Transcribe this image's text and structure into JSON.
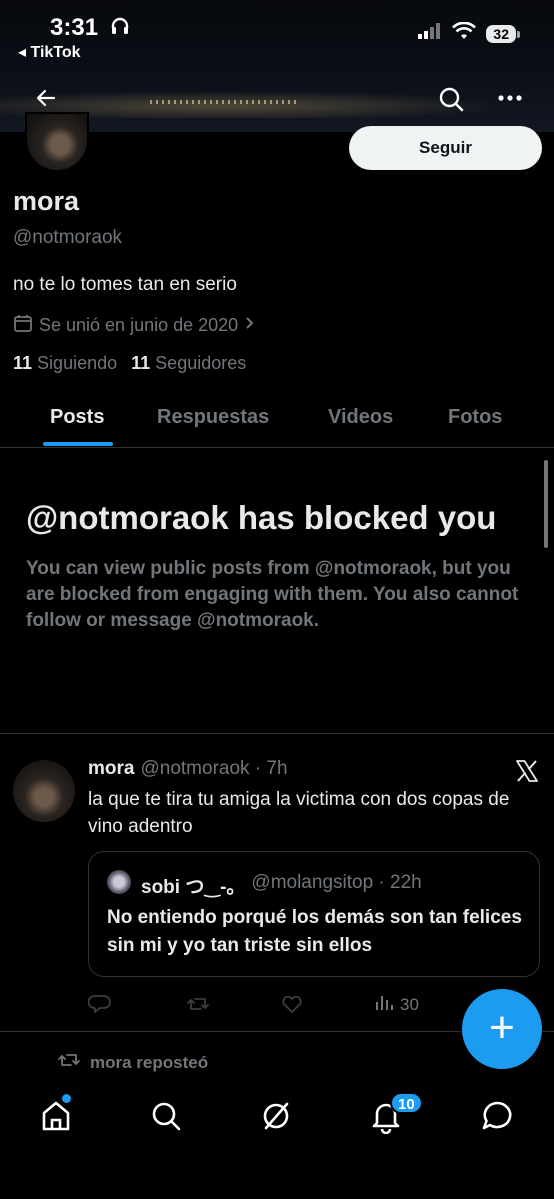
{
  "status_bar": {
    "time": "3:31",
    "back_app": "◂ TikTok",
    "battery": "32"
  },
  "profile": {
    "name": "mora",
    "handle": "@notmoraok",
    "bio": "no te lo tomes tan en serio",
    "joined": "Se unió en junio de 2020",
    "following_count": "11",
    "following_label": "Siguiendo",
    "followers_count": "11",
    "followers_label": "Seguidores",
    "follow_button": "Seguir"
  },
  "tabs": [
    {
      "label": "Posts",
      "active": true
    },
    {
      "label": "Respuestas",
      "active": false
    },
    {
      "label": "Videos",
      "active": false
    },
    {
      "label": "Fotos",
      "active": false
    }
  ],
  "blocked_notice": {
    "title": "@notmoraok has blocked you",
    "body": "You can view public posts from @notmoraok, but you are blocked from engaging with them. You also cannot follow or message @notmoraok."
  },
  "post": {
    "author": "mora",
    "meta": "@notmoraok · 7h",
    "text": "la que te tira tu amiga la victima con dos copas de vino adentro",
    "quote": {
      "author": "sobi つ‿-。",
      "meta": "@molangsitop · 22h",
      "text": "No entiendo porqué los demás son tan felices sin mi y yo tan triste sin ellos"
    },
    "views": "30"
  },
  "repost": {
    "label": "mora reposteó"
  },
  "bottom_nav": {
    "notifications_badge": "10"
  },
  "colors": {
    "accent": "#1d9bf0",
    "muted": "#71767b",
    "background": "#000000"
  }
}
